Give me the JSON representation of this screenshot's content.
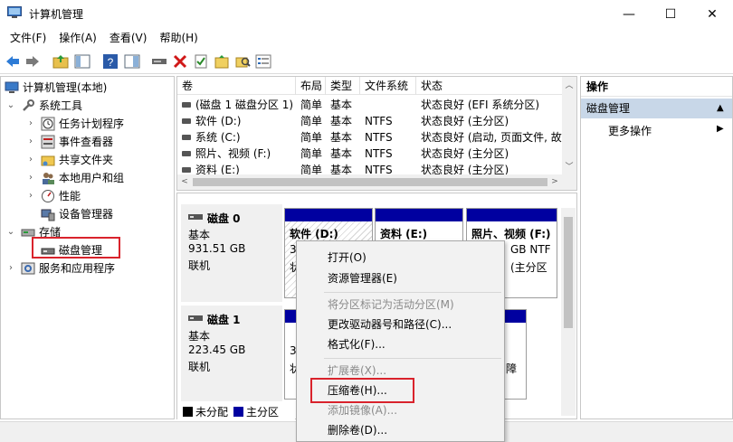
{
  "window": {
    "title": "计算机管理",
    "controls": [
      "—",
      "☐",
      "✕"
    ]
  },
  "menu": [
    "文件(F)",
    "操作(A)",
    "查看(V)",
    "帮助(H)"
  ],
  "tree": {
    "root": "计算机管理(本地)",
    "system_tools": "系统工具",
    "task_scheduler": "任务计划程序",
    "event_viewer": "事件查看器",
    "shared_folders": "共享文件夹",
    "local_users": "本地用户和组",
    "performance": "性能",
    "device_manager": "设备管理器",
    "storage": "存储",
    "disk_management": "磁盘管理",
    "services": "服务和应用程序"
  },
  "volumes": {
    "headers": [
      "卷",
      "布局",
      "类型",
      "文件系统",
      "状态"
    ],
    "rows": [
      [
        "(磁盘 1 磁盘分区 1)",
        "简单",
        "基本",
        "",
        "状态良好 (EFI 系统分区)"
      ],
      [
        "软件 (D:)",
        "简单",
        "基本",
        "NTFS",
        "状态良好 (主分区)"
      ],
      [
        "系统 (C:)",
        "简单",
        "基本",
        "NTFS",
        "状态良好 (启动, 页面文件, 故"
      ],
      [
        "照片、视频 (F:)",
        "简单",
        "基本",
        "NTFS",
        "状态良好 (主分区)"
      ],
      [
        "资料 (E:)",
        "简单",
        "基本",
        "NTFS",
        "状态良好 (主分区)"
      ]
    ]
  },
  "disks": [
    {
      "name": "磁盘 0",
      "type": "基本",
      "size": "931.51 GB",
      "status": "联机"
    },
    {
      "name": "磁盘 1",
      "type": "基本",
      "size": "223.45 GB",
      "status": "联机"
    }
  ],
  "partitions": {
    "d": {
      "title": "软件 (D:)",
      "l1": "3",
      "l2": "状"
    },
    "e": {
      "title": "资料 (E:)"
    },
    "f": {
      "title": "照片、视频 (F:)",
      "l1": "GB NTF",
      "l2": "(主分区"
    },
    "d1a": {
      "l1": "3",
      "l2": "状"
    },
    "d1b": {
      "l2": "障"
    }
  },
  "legend": {
    "unallocated": "未分配",
    "primary": "主分区"
  },
  "actions": {
    "header": "操作",
    "section": "磁盘管理",
    "more": "更多操作"
  },
  "context_menu": {
    "open": "打开(O)",
    "explorer": "资源管理器(E)",
    "mark_active": "将分区标记为活动分区(M)",
    "change_letter": "更改驱动器号和路径(C)...",
    "format": "格式化(F)...",
    "extend": "扩展卷(X)...",
    "shrink": "压缩卷(H)...",
    "mirror": "添加镜像(A)...",
    "delete": "删除卷(D)..."
  },
  "colors": {
    "primary_partition": "#0000a0",
    "unallocated": "#000000",
    "highlight": "#d9232c",
    "selection": "#c8d7e8"
  }
}
